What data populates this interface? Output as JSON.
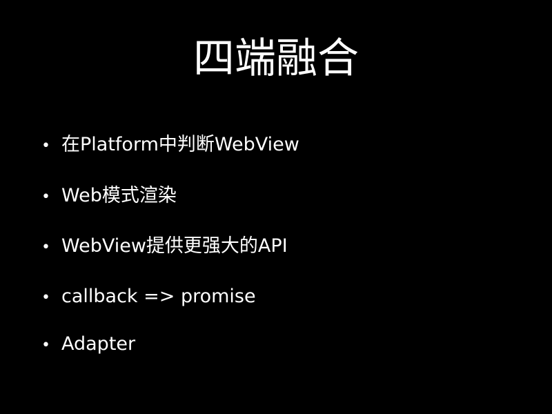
{
  "slide": {
    "title": "四端融合",
    "bullets": [
      {
        "marker": "•",
        "text": "在Platform中判断WebView"
      },
      {
        "marker": "•",
        "text": "Web模式渲染"
      },
      {
        "marker": "•",
        "text": "WebView提供更强大的API"
      },
      {
        "marker": "•",
        "text": "callback => promise"
      },
      {
        "marker": "•",
        "text": "Adapter"
      }
    ]
  },
  "colors": {
    "background": "#000000",
    "text": "#ffffff"
  }
}
